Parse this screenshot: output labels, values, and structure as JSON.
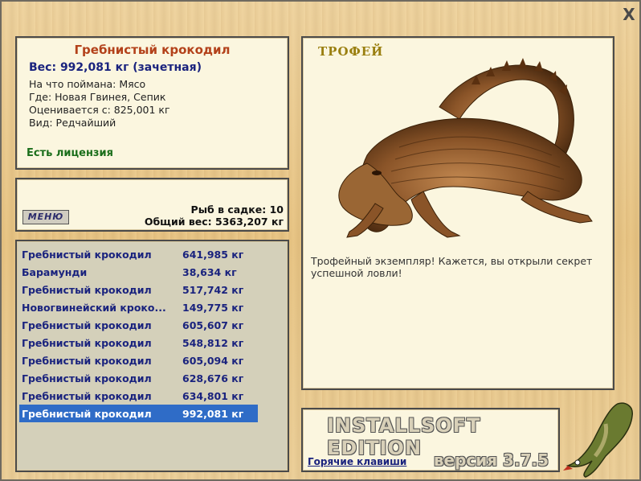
{
  "window": {
    "close_label": "X"
  },
  "info": {
    "title": "Гребнистый крокодил",
    "weight": "Вес: 992,081 кг (зачетная)",
    "bait": "На что поймана: Мясо",
    "place": "Где: Новая Гвинея, Сепик",
    "valued": "Оценивается с: 825,001 кг",
    "kind": "Вид: Редчайший",
    "license": "Есть лицензия"
  },
  "stats": {
    "menu_label": "МЕНЮ",
    "fish_in_cage": "Рыб в садке: 10",
    "total_weight": "Общий вес: 5363,207 кг"
  },
  "catch_list": [
    {
      "name": "Гребнистый крокодил",
      "weight": "641,985 кг"
    },
    {
      "name": "Барамунди",
      "weight": "38,634 кг"
    },
    {
      "name": "Гребнистый крокодил",
      "weight": "517,742 кг"
    },
    {
      "name": "Новогвинейский кроко...",
      "weight": "149,775 кг"
    },
    {
      "name": "Гребнистый крокодил",
      "weight": "605,607 кг"
    },
    {
      "name": "Гребнистый крокодил",
      "weight": "548,812 кг"
    },
    {
      "name": "Гребнистый крокодил",
      "weight": "605,094 кг"
    },
    {
      "name": "Гребнистый крокодил",
      "weight": "628,676 кг"
    },
    {
      "name": "Гребнистый крокодил",
      "weight": "634,801 кг"
    },
    {
      "name": "Гребнистый крокодил",
      "weight": "992,081 кг"
    }
  ],
  "selected_index": 9,
  "trophy": {
    "title": "ТРОФЕЙ",
    "description": "Трофейный экземпляр! Кажется, вы открыли секрет успешной ловли!"
  },
  "brand": {
    "name": "INSTALLSOFT EDITION",
    "hotkeys": "Горячие клавиши",
    "version": "версия 3.7.5"
  },
  "colors": {
    "selection": "#2f6cc7",
    "title": "#b3411a",
    "weight": "#1a237e",
    "license": "#1b6e1b",
    "trophy": "#9a7f10"
  }
}
